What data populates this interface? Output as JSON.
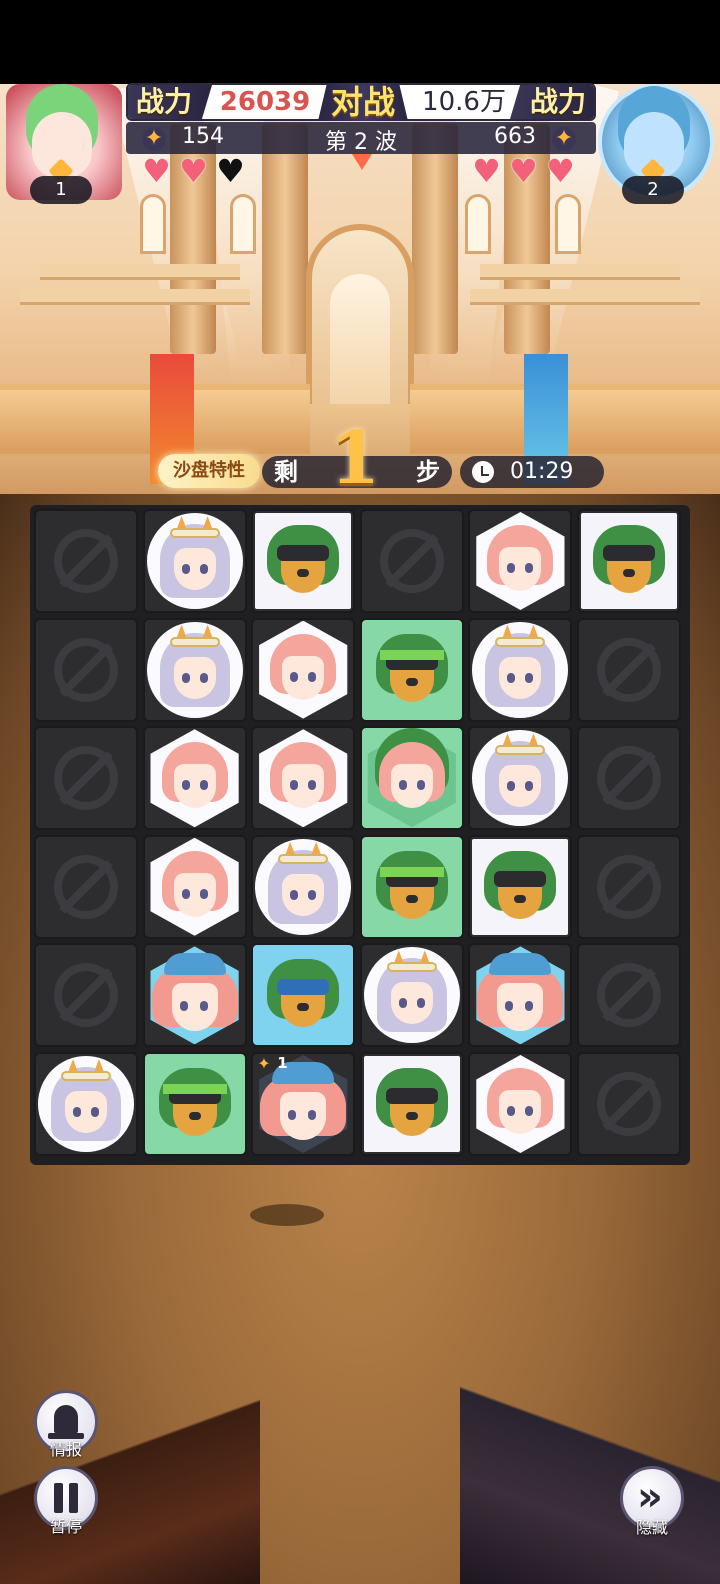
{
  "hud": {
    "left_power_label": "战力",
    "left_power_value": "26039",
    "vs_label": "对战",
    "right_power_value": "10.6万",
    "right_power_label": "战力",
    "left_wave_value": "154",
    "wave_text": "第 2 波",
    "right_wave_value": "663",
    "left_rank": "1",
    "right_rank": "2",
    "left_hearts": [
      "full",
      "full",
      "empty"
    ],
    "right_hearts": [
      "full",
      "full",
      "full"
    ]
  },
  "status": {
    "sandtable_label": "沙盘特性",
    "steps_prefix": "剩",
    "steps_remaining": "1",
    "steps_suffix": "步",
    "timer": "01:29"
  },
  "board": {
    "rows": 6,
    "cols": 6,
    "cells": [
      [
        "blocked",
        "silver_circle",
        "wolf_square",
        "blocked",
        "pink_hex",
        "wolf_square"
      ],
      [
        "blocked",
        "silver_circle",
        "pink_hex",
        "wolfband_green",
        "silver_circle",
        "blocked"
      ],
      [
        "blocked",
        "pink_hex",
        "pink_hex",
        "pinkcap_green",
        "silver_circle",
        "blocked"
      ],
      [
        "blocked",
        "pink_hex",
        "silver_circle",
        "wolfband_green",
        "wolf_square",
        "blocked"
      ],
      [
        "blocked",
        "boy_blue",
        "wolfblue_blue",
        "silver_circle",
        "boy_blue",
        "blocked"
      ],
      [
        "silver_circle",
        "wolfband_green",
        "boy_dark_badge",
        "wolf_square",
        "pink_hex",
        "blocked"
      ]
    ],
    "badge_value": "1"
  },
  "buttons": {
    "intel_label": "情报",
    "pause_label": "暂停",
    "hide_label": "隐藏"
  },
  "colors": {
    "tile_green": "#86d8a6",
    "tile_blue": "#7fd3ee",
    "tile_dark": "#2d2d30",
    "heart": "#f3607a",
    "power_red": "#d9534f"
  }
}
